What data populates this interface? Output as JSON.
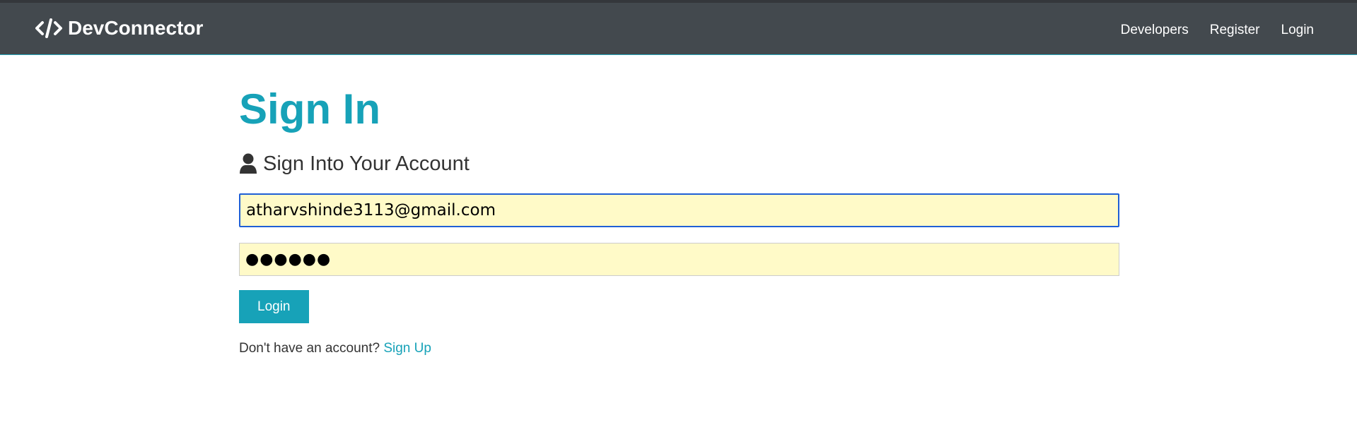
{
  "navbar": {
    "brand_label": "DevConnector",
    "brand_icon": "code-icon",
    "links": [
      {
        "label": "Developers"
      },
      {
        "label": "Register"
      },
      {
        "label": "Login"
      }
    ]
  },
  "main": {
    "title": "Sign In",
    "lead_text": "Sign Into Your Account",
    "lead_icon": "user-icon",
    "email": {
      "value": "atharvshinde3113@gmail.com"
    },
    "password": {
      "masked_value": "●●●●●●"
    },
    "submit_label": "Login",
    "signup_prompt": "Don't have an account?",
    "signup_link": "Sign Up"
  },
  "colors": {
    "primary": "#17a2b8",
    "navbar_bg": "#343a40",
    "autofill_bg": "#fffac8"
  }
}
